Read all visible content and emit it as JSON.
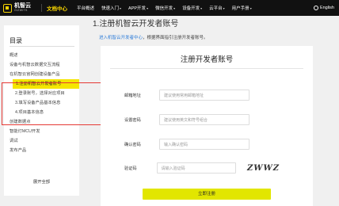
{
  "nav": {
    "logo_cn": "机智云",
    "logo_en": "GIZWITS",
    "doc_center": "文档中心",
    "items": [
      {
        "label": "平台概述",
        "caret": false
      },
      {
        "label": "快速入门",
        "caret": true
      },
      {
        "label": "APP开发",
        "caret": true
      },
      {
        "label": "微信开发",
        "caret": true
      },
      {
        "label": "设备开发",
        "caret": true
      },
      {
        "label": "云平台",
        "caret": true
      },
      {
        "label": "用户手册",
        "caret": true
      }
    ],
    "language": "English"
  },
  "sidebar": {
    "title": "目录",
    "items": [
      {
        "label": "概述",
        "level": 0,
        "active": false
      },
      {
        "label": "设备与机智云数据交互流程",
        "level": 0,
        "active": false
      },
      {
        "label": "在机智云官网创建设备产品",
        "level": 0,
        "active": false
      },
      {
        "label": "1.注册机智云开发者账号",
        "level": 1,
        "active": true
      },
      {
        "label": "2.登录账号，选择对应项目",
        "level": 1,
        "active": false
      },
      {
        "label": "3.填写设备产品基本信息",
        "level": 1,
        "active": false
      },
      {
        "label": "4.项目基本信息",
        "level": 1,
        "active": false
      },
      {
        "label": "创建数据点",
        "level": 0,
        "active": false
      },
      {
        "label": "智能灯MCU开发",
        "level": 0,
        "active": false
      },
      {
        "label": "调试",
        "level": 0,
        "active": false
      },
      {
        "label": "发布产品",
        "level": 0,
        "active": false
      }
    ],
    "expand_all": "展开全部"
  },
  "main": {
    "title": "1.注册机智云开发者账号",
    "intro_link": "进入机智云开发者中心",
    "intro_rest": "，根据界面指引注册开发者账号。",
    "card": {
      "title": "注册开发者账号",
      "fields": [
        {
          "label": "邮箱地址",
          "placeholder": "建议使用常用邮箱地址"
        },
        {
          "label": "设置密码",
          "placeholder": "建议使用英文和符号组合"
        },
        {
          "label": "确认密码",
          "placeholder": "输入确认密码"
        },
        {
          "label": "验证码",
          "placeholder": "请输入验证码"
        }
      ],
      "captcha_text": "ZWWZ",
      "submit_label": "立即注册"
    }
  }
}
